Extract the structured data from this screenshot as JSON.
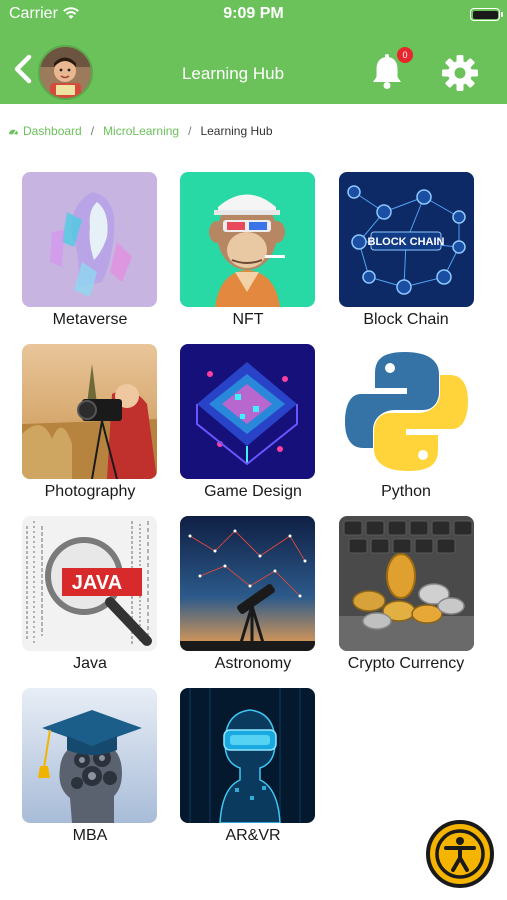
{
  "status_bar": {
    "carrier": "Carrier",
    "time": "9:09 PM"
  },
  "header": {
    "title": "Learning Hub",
    "notification_count": "0",
    "color": "#6bc15a"
  },
  "breadcrumb": [
    {
      "label": "Dashboard",
      "icon": "dashboard-icon"
    },
    {
      "label": "MicroLearning"
    },
    {
      "label": "Learning Hub"
    }
  ],
  "topics": [
    {
      "label": "Metaverse"
    },
    {
      "label": "NFT"
    },
    {
      "label": "Block Chain",
      "image_text": "BLOCK CHAIN"
    },
    {
      "label": "Photography"
    },
    {
      "label": "Game Design"
    },
    {
      "label": "Python"
    },
    {
      "label": "Java",
      "image_text": "JAVA"
    },
    {
      "label": "Astronomy"
    },
    {
      "label": "Crypto Currency"
    },
    {
      "label": "MBA"
    },
    {
      "label": "AR&VR"
    }
  ],
  "accessibility_button": {
    "icon": "accessibility-icon",
    "color": "#f5b400"
  }
}
